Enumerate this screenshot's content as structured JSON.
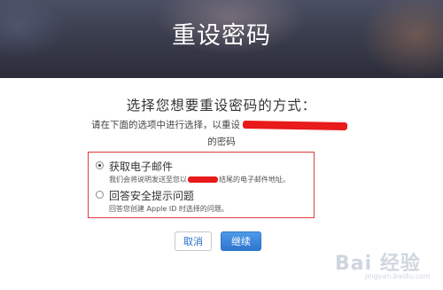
{
  "header": {
    "title": "重设密码"
  },
  "main": {
    "headline": "选择您想要重设密码的方式：",
    "subline_prefix": "请在下面的选项中进行选择，以重设",
    "subline_suffix": "的密码"
  },
  "options": [
    {
      "label": "获取电子邮件",
      "desc_prefix": "我们会将说明发送至您以",
      "desc_suffix": "结尾的电子邮件地址。",
      "selected": true
    },
    {
      "label": "回答安全提示问题",
      "desc": "回答您创建 Apple ID 时选择的问题。",
      "selected": false
    }
  ],
  "buttons": {
    "cancel": "取消",
    "continue": "继续"
  },
  "watermark": {
    "main": "Bai 经验",
    "sub": "jingyan.baidu.com"
  },
  "colors": {
    "redaction": "#e81a1a",
    "primary_button": "#2d76cf",
    "link": "#2a6fc9",
    "highlight_box": "#e23b3b"
  }
}
